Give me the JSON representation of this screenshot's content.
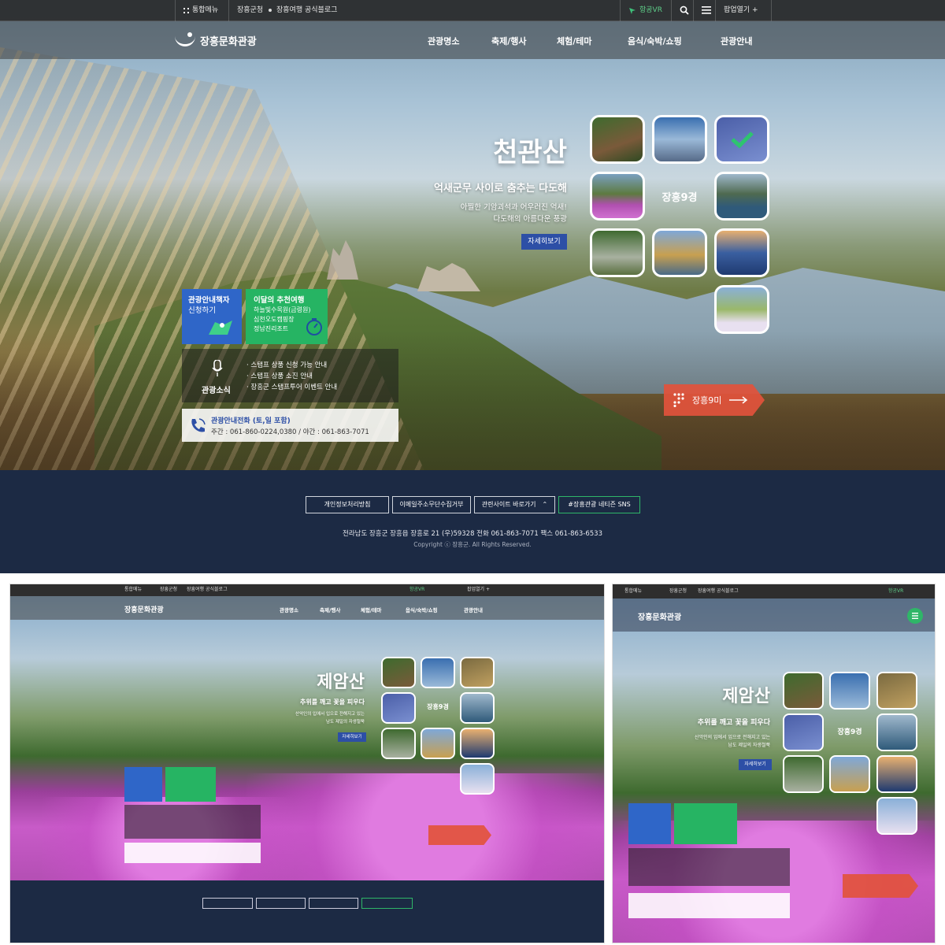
{
  "topbar": {
    "all_menu": "통합메뉴",
    "county": "장흥군청",
    "blog": "장흥여행 공식블로그",
    "vr": "항공VR",
    "popup": "팝업열기 +"
  },
  "gnb": {
    "brand": "장흥문화관광",
    "menus": [
      "관광명소",
      "축제/행사",
      "체험/테마",
      "음식/숙박/쇼핑",
      "관광안내"
    ]
  },
  "hero": {
    "title": "천관산",
    "subtitle": "억새군무 사이로 춤추는 다도해",
    "desc1": "아찔한 기암괴석과 어우러진 억새!",
    "desc2": "다도해의 아름다운 풍광",
    "detail_btn": "자세히보기",
    "nine_label": "장흥9경",
    "nine_btn": "장흥9미"
  },
  "cards": {
    "guide_title1": "관광안내책자",
    "guide_title2": "신청하기",
    "recommend_title": "이달의 추천여행",
    "recommend_items": [
      "하늘빛수목원(금령원)",
      "심천오도캠핑장",
      "정남진리조트"
    ]
  },
  "news": {
    "label": "관광소식",
    "items": [
      "스탬프 상품 신청 가능 안내",
      "스탬프 상품 소진 안내",
      "장흥군 스탬프투어 이벤트 안내"
    ]
  },
  "phone": {
    "title": "관광안내전화 (토,일 포함)",
    "numbers": "주간 : 061-860-0224,0380 / 야간 : 061-863-7071"
  },
  "footer": {
    "links": [
      "개인정보처리방침",
      "이메일주소무단수집거부",
      "관련사이트 바로가기",
      "#장흥관광 네티즌 SNS"
    ],
    "address": "전라남도 장흥군 장흥읍 장흥로 21 (우)59328 전화 061-863-7071 팩스 061-863-6533",
    "copyright": "Copyright ⓒ 장흥군. All Rights Reserved."
  },
  "mini": {
    "title": "제암산",
    "subtitle": "추위를 깨고 꽃을 피우다",
    "desc1": "산악인의 입에서 입으로 전해지고 있는",
    "desc2": "남도 제일의 자생철쭉"
  },
  "colors": {
    "footer_bg": "#1c2a44",
    "accent_blue": "#2f66c8",
    "accent_green": "#26b463",
    "accent_red": "#e2523c"
  }
}
